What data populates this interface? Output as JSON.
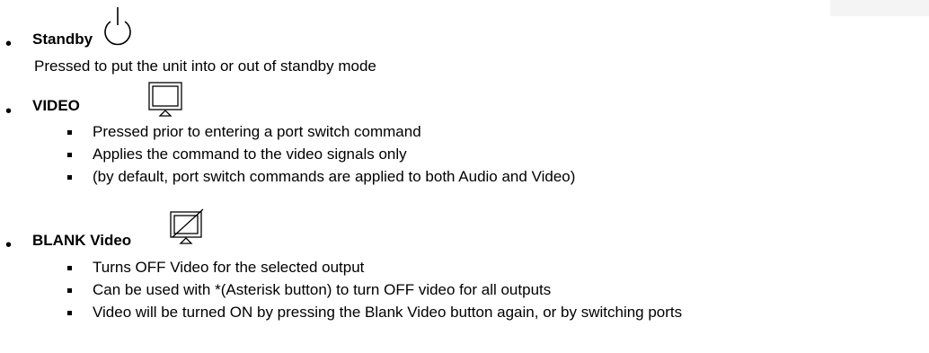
{
  "sections": [
    {
      "title": "Standby",
      "icon": "power-icon",
      "description": "Pressed to put the unit into or out of standby mode"
    },
    {
      "title": "VIDEO",
      "icon": "monitor-icon",
      "items": [
        "Pressed prior to entering a port switch command",
        "Applies the command to the video signals only",
        "(by default, port switch commands are applied to both Audio and Video)"
      ]
    },
    {
      "title": "BLANK Video",
      "icon": "blank-monitor-icon",
      "items": [
        "Turns OFF Video for the selected output",
        "Can be used with *(Asterisk button) to turn OFF video for all outputs",
        "Video will be turned ON by pressing the Blank Video button again, or by switching ports"
      ]
    }
  ]
}
